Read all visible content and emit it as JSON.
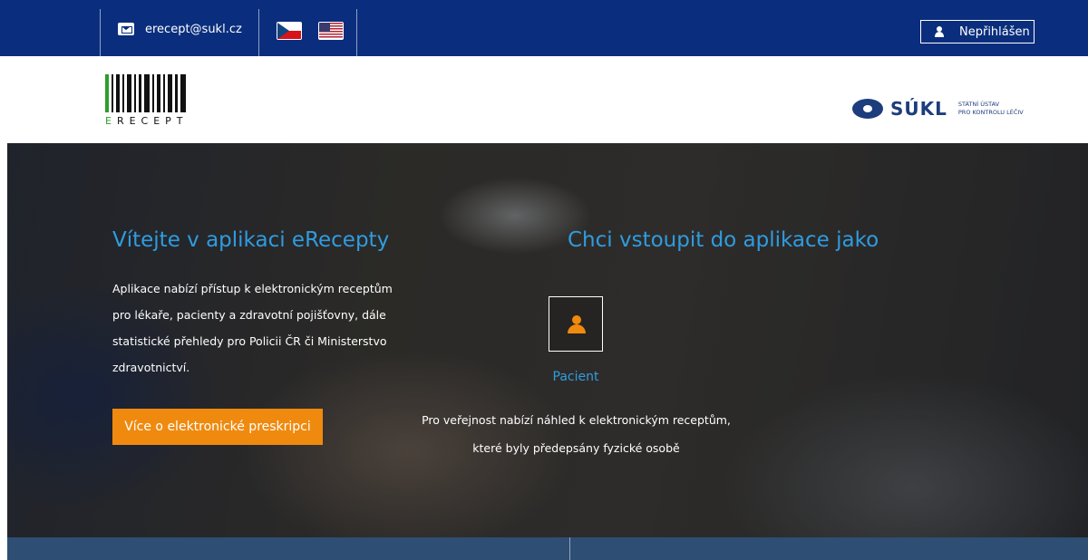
{
  "topbar": {
    "email": "erecept@sukl.cz",
    "languages": [
      {
        "code": "cs",
        "icon": "czech-flag-icon"
      },
      {
        "code": "en",
        "icon": "us-flag-icon"
      }
    ],
    "login_label": "Nepřihlášen",
    "background": "#0a2e7d"
  },
  "header": {
    "logo_text": "ERECEPT",
    "sukl_name": "SÚKL",
    "sukl_sub_line1": "STÁTNÍ ÚSTAV",
    "sukl_sub_line2": "PRO KONTROLU LÉČIV"
  },
  "hero": {
    "left_title": "Vítejte v aplikaci eRecepty",
    "left_desc": "Aplikace nabízí přístup k elektronickým receptům pro lékaře, pacienty a zdravotní pojišťovny, dále statistické přehledy pro Policii ČR či Ministerstvo zdravotnictví.",
    "cta_label": "Více o elektronické preskripci",
    "right_title": "Chci vstoupit do aplikace jako",
    "patient_label": "Pacient",
    "patient_desc": "Pro veřejnost nabízí náhled k elektronickým receptům, které byly předepsány fyzické osobě",
    "accent_color": "#2f9ce0",
    "cta_color": "#ef8a0f"
  }
}
